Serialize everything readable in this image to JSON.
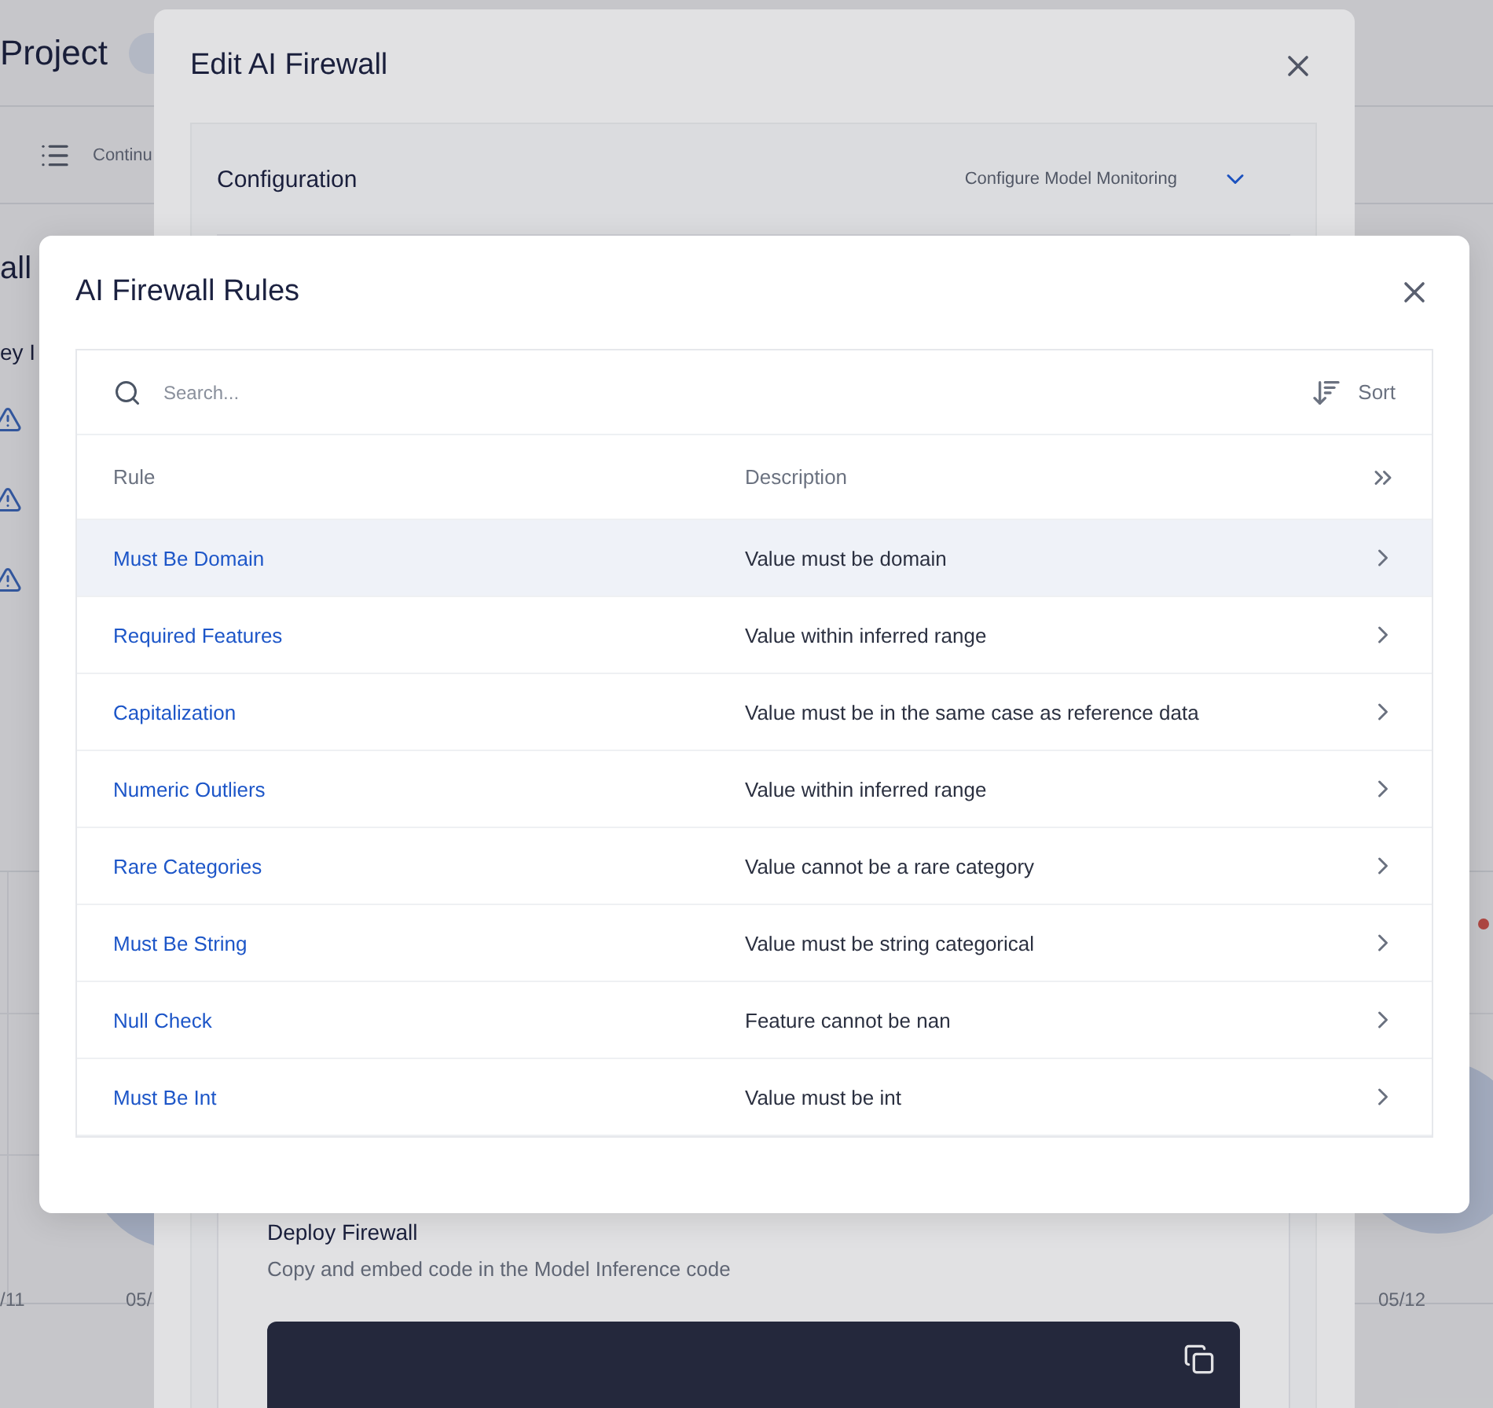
{
  "background_page": {
    "title": "Project",
    "toolbar_label": "Continu",
    "section_title": "all",
    "subheading": "ey I",
    "axis_labels": [
      "/11",
      "05/",
      "05/12"
    ]
  },
  "edit_dialog": {
    "title": "Edit AI Firewall",
    "configuration": {
      "title": "Configuration",
      "value": "Configure Model Monitoring"
    },
    "deploy": {
      "title": "Deploy Firewall",
      "description": "Copy and embed code in the Model Inference code"
    }
  },
  "rules_dialog": {
    "title": "AI Firewall Rules",
    "search": {
      "placeholder": "Search..."
    },
    "sort_label": "Sort",
    "columns": [
      "Rule",
      "Description"
    ],
    "rows": [
      {
        "rule": "Must Be Domain",
        "description": "Value must be domain",
        "selected": true
      },
      {
        "rule": "Required Features",
        "description": "Value within inferred range",
        "selected": false
      },
      {
        "rule": "Capitalization",
        "description": "Value must be in the same case as reference data",
        "selected": false
      },
      {
        "rule": "Numeric Outliers",
        "description": "Value within inferred range",
        "selected": false
      },
      {
        "rule": "Rare Categories",
        "description": "Value cannot be a rare category",
        "selected": false
      },
      {
        "rule": "Must Be String",
        "description": "Value must be string categorical",
        "selected": false
      },
      {
        "rule": "Null Check",
        "description": "Feature cannot be nan",
        "selected": false
      },
      {
        "rule": "Must Be Int",
        "description": "Value must be int",
        "selected": false
      }
    ]
  }
}
